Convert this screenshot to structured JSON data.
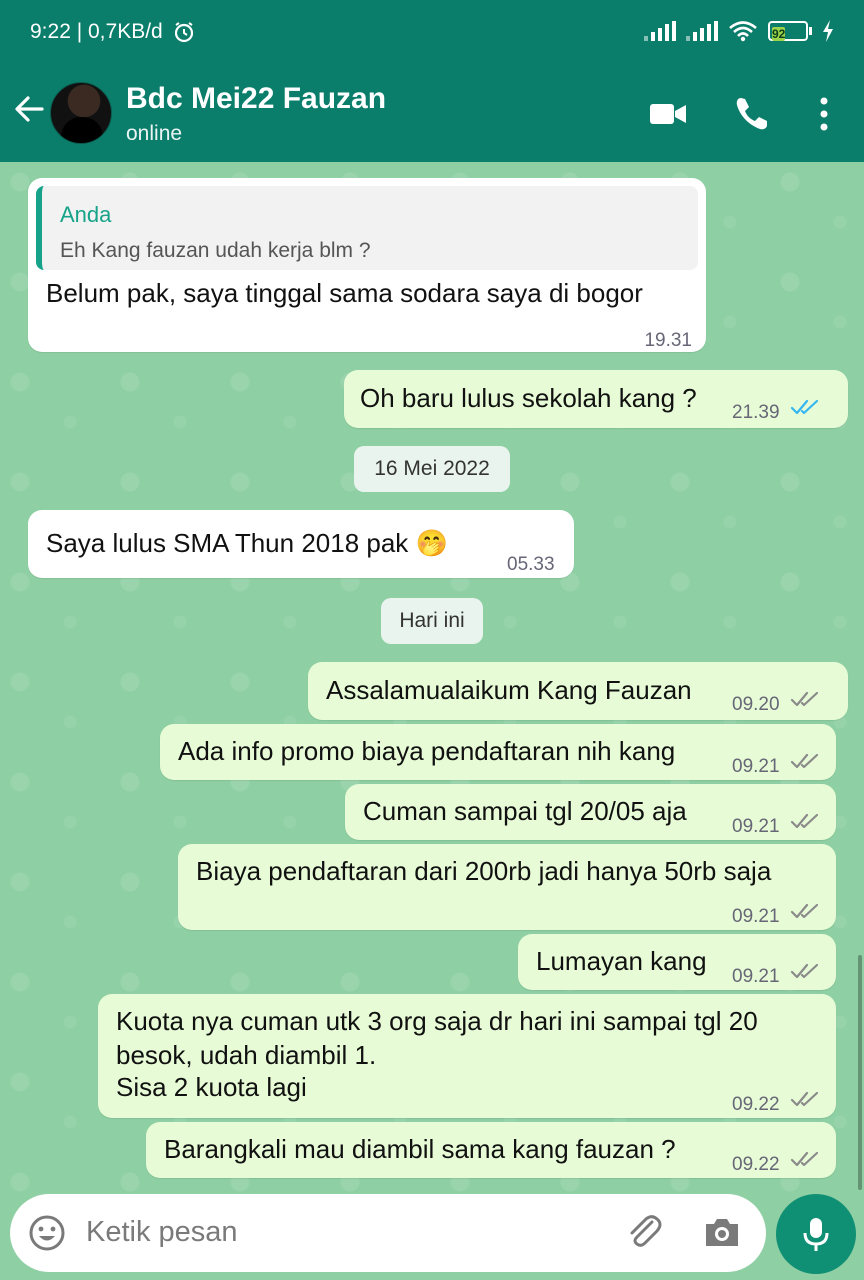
{
  "status_bar": {
    "time_net": "9:22 | 0,7KB/d",
    "battery": "92",
    "icons": [
      "alarm-icon",
      "signal-icon",
      "signal-icon",
      "wifi-icon",
      "battery-icon",
      "charging-icon"
    ]
  },
  "header": {
    "name": "Bdc Mei22 Fauzan",
    "status": "online",
    "icons": [
      "back-arrow-icon",
      "video-call-icon",
      "phone-icon",
      "more-vert-icon"
    ]
  },
  "messages": [
    {
      "dir": "in",
      "quote_name": "Anda",
      "quote_text": "Eh Kang fauzan udah kerja blm ?",
      "text": "Belum pak, saya tinggal sama sodara saya di bogor",
      "time": "19.31"
    },
    {
      "dir": "out",
      "text": "Oh baru lulus sekolah kang ?",
      "time": "21.39",
      "read": true
    },
    {
      "date": "16 Mei 2022"
    },
    {
      "dir": "in",
      "text": "Saya lulus SMA Thun 2018 pak 🤭",
      "time": "05.33"
    },
    {
      "date": "Hari ini"
    },
    {
      "dir": "out",
      "text": "Assalamualaikum Kang Fauzan",
      "time": "09.20",
      "read": false
    },
    {
      "dir": "out",
      "text": "Ada info promo biaya pendaftaran nih kang",
      "time": "09.21",
      "read": false
    },
    {
      "dir": "out",
      "text": "Cuman sampai tgl 20/05 aja",
      "time": "09.21",
      "read": false
    },
    {
      "dir": "out",
      "text": "Biaya pendaftaran dari 200rb jadi hanya 50rb saja",
      "time": "09.21",
      "read": false
    },
    {
      "dir": "out",
      "text": "Lumayan kang",
      "time": "09.21",
      "read": false
    },
    {
      "dir": "out",
      "line1": "Kuota nya cuman utk 3 org saja dr hari ini sampai tgl 20",
      "line2": "besok, udah diambil 1.",
      "line3": "Sisa 2 kuota lagi",
      "time": "09.22",
      "read": false
    },
    {
      "dir": "out",
      "text": "Barangkali mau diambil sama kang fauzan ?",
      "time": "09.22",
      "read": false
    }
  ],
  "input": {
    "placeholder": "Ketik pesan",
    "icons": [
      "emoji-icon",
      "attach-icon",
      "camera-icon",
      "mic-icon"
    ]
  },
  "colors": {
    "header": "#0a7e6b",
    "chat_bg": "#8ecfa3",
    "incoming": "#ffffff",
    "outgoing": "#e7fcd6",
    "read_tick": "#34b7f1",
    "unread_tick": "#8a8a8a",
    "mic_button": "#0f8f74"
  }
}
